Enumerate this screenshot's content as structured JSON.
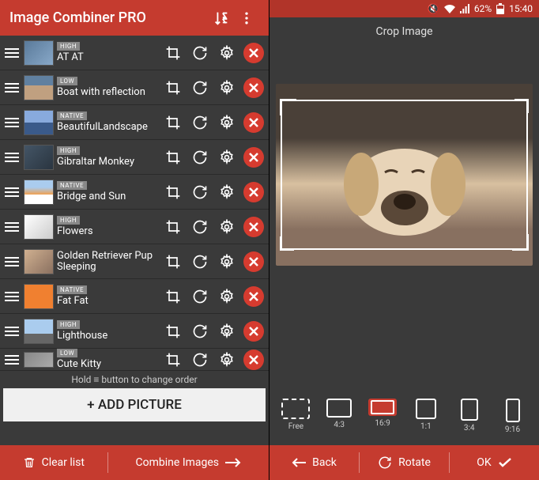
{
  "app": {
    "title": "Image Combiner PRO"
  },
  "status": {
    "battery_pct": "62%",
    "time": "15:40"
  },
  "items": [
    {
      "badge": "HIGH",
      "name": "AT AT"
    },
    {
      "badge": "LOW",
      "name": "Boat with reflection"
    },
    {
      "badge": "NATIVE",
      "name": "BeautifulLandscape"
    },
    {
      "badge": "HIGH",
      "name": "Gibraltar Monkey"
    },
    {
      "badge": "NATIVE",
      "name": "Bridge and Sun"
    },
    {
      "badge": "HIGH",
      "name": "Flowers"
    },
    {
      "badge": "",
      "name": "Golden Retriever Pup Sleeping"
    },
    {
      "badge": "NATIVE",
      "name": "Fat Fat"
    },
    {
      "badge": "HIGH",
      "name": "Lighthouse"
    },
    {
      "badge": "LOW",
      "name": "Cute Kitty"
    }
  ],
  "hint": "Hold ≡ button to change order",
  "add_label": "+ ADD PICTURE",
  "footer_left": {
    "clear": "Clear list",
    "combine": "Combine Images"
  },
  "crop": {
    "title": "Crop Image",
    "ratios": [
      {
        "label": "Free"
      },
      {
        "label": "4:3"
      },
      {
        "label": "16:9"
      },
      {
        "label": "1:1"
      },
      {
        "label": "3:4"
      },
      {
        "label": "9:16"
      }
    ],
    "back": "Back",
    "rotate": "Rotate",
    "ok": "OK"
  }
}
